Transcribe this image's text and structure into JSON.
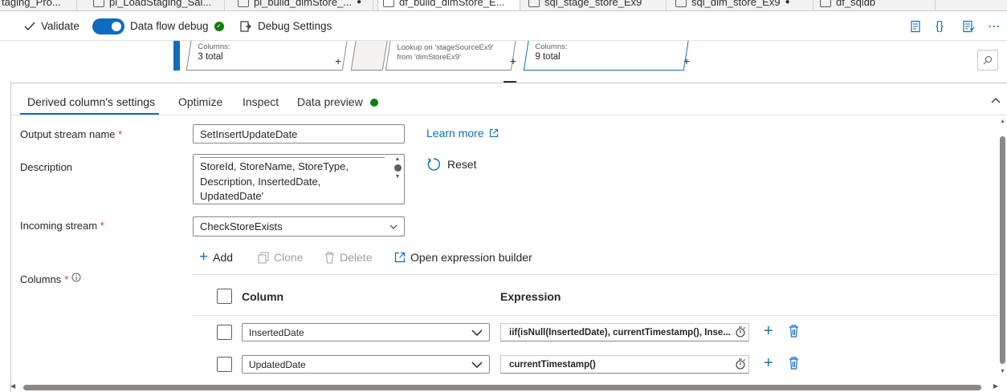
{
  "tabs": [
    {
      "label": "taging_Pro..."
    },
    {
      "label": "pl_LoadStaging_Sal..."
    },
    {
      "label": "pl_build_dimStore_..."
    },
    {
      "label": "df_build_dimStore_E..."
    },
    {
      "label": "sql_stage_store_Ex9"
    },
    {
      "label": "sql_dim_store_Ex9"
    },
    {
      "label": "df_sqldb"
    }
  ],
  "toolbar": {
    "validate": "Validate",
    "debug_toggle": "Data flow debug",
    "debug_settings": "Debug Settings"
  },
  "canvas": {
    "node1": {
      "sub": "Columns:",
      "value": "3 total"
    },
    "node2": {
      "line1": "Lookup on 'stageSourceEx9'",
      "line2": "from 'dimStoreEx9'"
    },
    "node3": {
      "sub": "Columns:",
      "value": "9 total"
    },
    "plus": "+"
  },
  "settings_tabs": [
    {
      "label": "Derived column's settings"
    },
    {
      "label": "Optimize"
    },
    {
      "label": "Inspect"
    },
    {
      "label": "Data preview"
    }
  ],
  "form": {
    "output_stream_label": "Output stream name",
    "output_stream_value": "SetInsertUpdateDate",
    "learn_more": "Learn more",
    "description_label": "Description",
    "description_lines": [
      "StoreId, StoreName, StoreType,",
      "Description, InsertedDate,",
      "UpdatedDate'"
    ],
    "reset": "Reset",
    "incoming_label": "Incoming stream",
    "incoming_value": "CheckStoreExists",
    "columns_label": "Columns",
    "required_mark": "*"
  },
  "commands": {
    "add": "Add",
    "clone": "Clone",
    "delete": "Delete",
    "open_builder": "Open expression builder"
  },
  "table": {
    "headers": {
      "column": "Column",
      "expression": "Expression"
    },
    "rows": [
      {
        "column": "InsertedDate",
        "expression": "iif(isNull(InsertedDate), currentTimestamp(), Inse..."
      },
      {
        "column": "UpdatedDate",
        "expression": "currentTimestamp()"
      }
    ]
  },
  "colors": {
    "accent": "#0f6cbd",
    "success": "#107c10",
    "required": "#d13438"
  }
}
